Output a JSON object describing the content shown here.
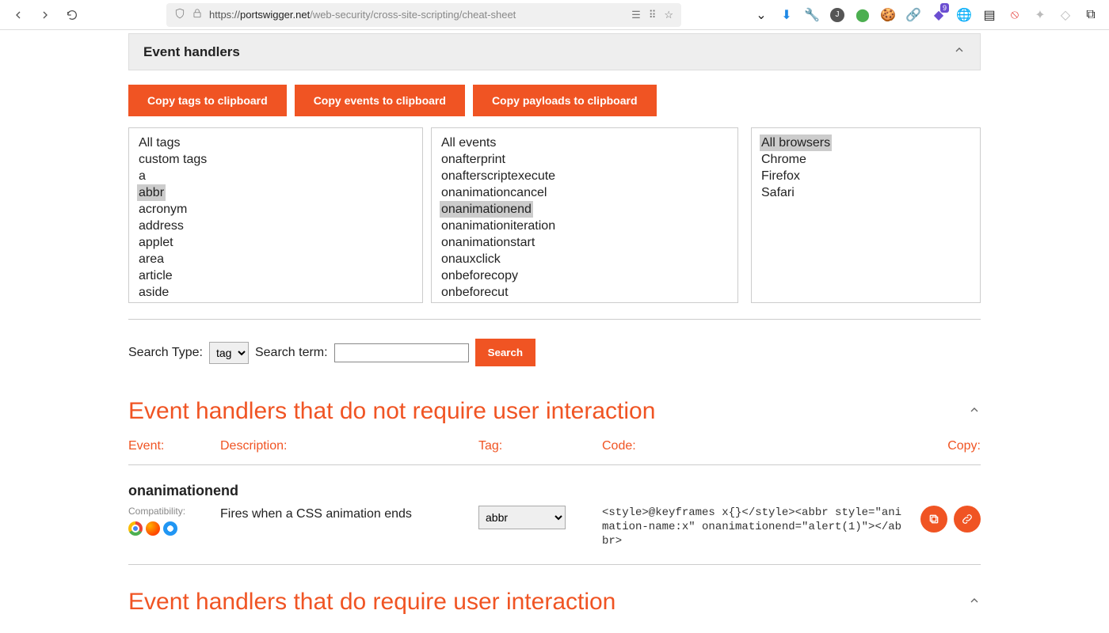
{
  "browser": {
    "url_host": "portswigger.net",
    "url_path": "/web-security/cross-site-scripting/cheat-sheet",
    "toolbar_badge": "9"
  },
  "section": {
    "title": "Event handlers"
  },
  "copy_buttons": {
    "tags": "Copy tags to clipboard",
    "events": "Copy events to clipboard",
    "payloads": "Copy payloads to clipboard"
  },
  "lists": {
    "tags": [
      "All tags",
      "custom tags",
      "a",
      "abbr",
      "acronym",
      "address",
      "applet",
      "area",
      "article",
      "aside"
    ],
    "tags_selected": "abbr",
    "events": [
      "All events",
      "onafterprint",
      "onafterscriptexecute",
      "onanimationcancel",
      "onanimationend",
      "onanimationiteration",
      "onanimationstart",
      "onauxclick",
      "onbeforecopy",
      "onbeforecut"
    ],
    "events_selected": "onanimationend",
    "browsers": [
      "All browsers",
      "Chrome",
      "Firefox",
      "Safari"
    ],
    "browsers_selected": "All browsers"
  },
  "search": {
    "type_label": "Search Type:",
    "type_value": "tag",
    "term_label": "Search term:",
    "term_value": "",
    "button": "Search"
  },
  "headings": {
    "no_interaction": "Event handlers that do not require user interaction",
    "with_interaction": "Event handlers that do require user interaction"
  },
  "columns": {
    "event": "Event:",
    "description": "Description:",
    "tag": "Tag:",
    "code": "Code:",
    "copy": "Copy:"
  },
  "result": {
    "event_name": "onanimationend",
    "compat_label": "Compatibility:",
    "description": "Fires when a CSS animation ends",
    "tag_value": "abbr",
    "code": "<style>@keyframes x{}</style><abbr style=\"animation-name:x\" onanimationend=\"alert(1)\"></abbr>"
  }
}
